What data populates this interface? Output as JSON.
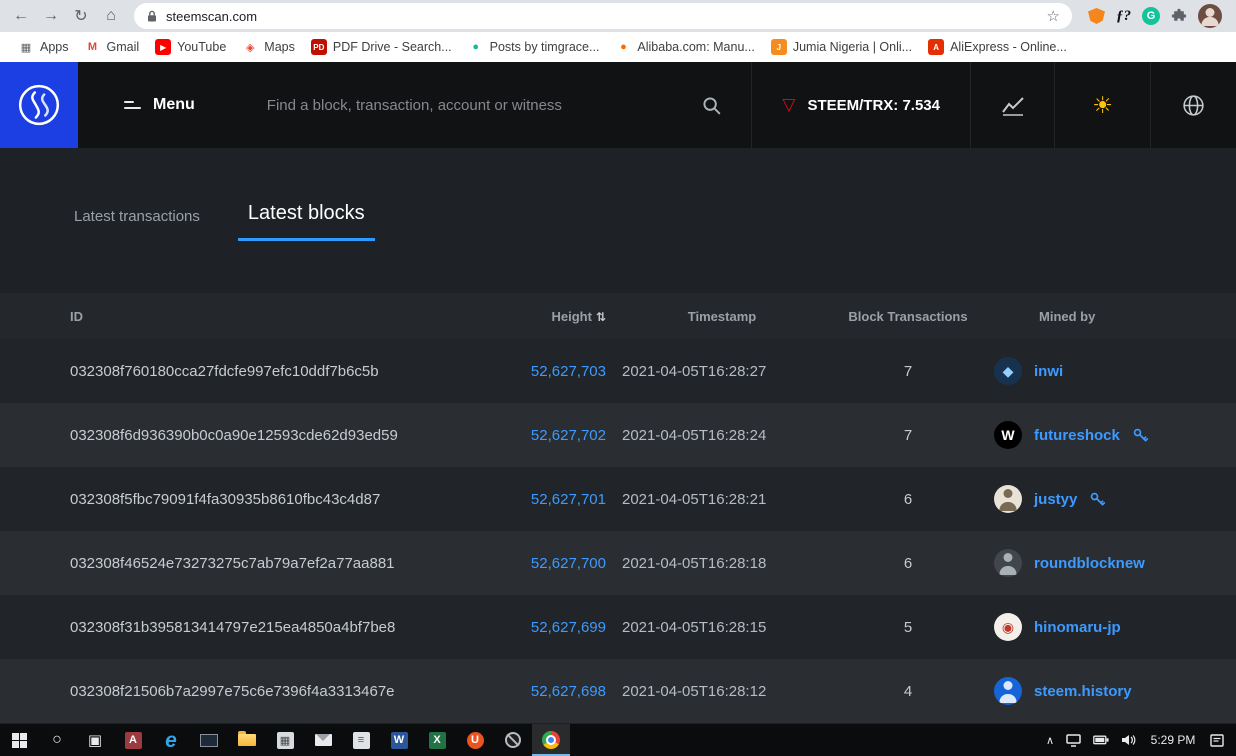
{
  "icons": {
    "back": "←",
    "forward": "→",
    "reload": "↻",
    "home": "⌂",
    "star": "☆",
    "extension_f": "ƒ?",
    "grammarly": "G",
    "sun": "☀",
    "tron": "▽",
    "sort": "⇅",
    "chevron_up": "∧"
  },
  "browser": {
    "url": "steemscan.com",
    "bookmarks": [
      {
        "label": "Apps",
        "glyph": "▦",
        "color": "#5f6368",
        "tile": false
      },
      {
        "label": "Gmail",
        "glyph": "M",
        "color": "#ea4335",
        "tile": false
      },
      {
        "label": "YouTube",
        "glyph": "▶",
        "color": "#ff0000",
        "tile": true
      },
      {
        "label": "Maps",
        "glyph": "◈",
        "color": "#ea4335",
        "tile": false
      },
      {
        "label": "PDF Drive - Search...",
        "glyph": "PD",
        "color": "#c00e00",
        "tile": true
      },
      {
        "label": "Posts by timgrace...",
        "glyph": "●",
        "color": "#17b79a",
        "tile": false
      },
      {
        "label": "Alibaba.com: Manu...",
        "glyph": "●",
        "color": "#ff6a00",
        "tile": false
      },
      {
        "label": "Jumia Nigeria | Onli...",
        "glyph": "J",
        "color": "#f68b1e",
        "tile": true
      },
      {
        "label": "AliExpress - Online...",
        "glyph": "A",
        "color": "#e62e04",
        "tile": true
      }
    ]
  },
  "site_header": {
    "menu_label": "Menu",
    "search_placeholder": "Find a block, transaction, account or witness",
    "pair_label": "STEEM/TRX: 7.534"
  },
  "tabs": {
    "transactions": "Latest transactions",
    "blocks": "Latest blocks"
  },
  "table": {
    "headers": {
      "id": "ID",
      "height": "Height",
      "timestamp": "Timestamp",
      "transactions": "Block Transactions",
      "mined_by": "Mined by"
    },
    "rows": [
      {
        "id": "032308f760180cca27fdcfe997efc10ddf7b6c5b",
        "height": "52,627,703",
        "timestamp": "2021-04-05T16:28:27",
        "transactions": "7",
        "miner": "inwi",
        "has_key": false,
        "avatar": {
          "type": "glyph",
          "glyph": "◆",
          "bg": "#16324f",
          "fg": "#8fd0ff"
        }
      },
      {
        "id": "032308f6d936390b0c0a90e12593cde62d93ed59",
        "height": "52,627,702",
        "timestamp": "2021-04-05T16:28:24",
        "transactions": "7",
        "miner": "futureshock",
        "has_key": true,
        "avatar": {
          "type": "glyph",
          "glyph": "W",
          "bg": "#000000",
          "fg": "#ffffff"
        }
      },
      {
        "id": "032308f5fbc79091f4fa30935b8610fbc43c4d87",
        "height": "52,627,701",
        "timestamp": "2021-04-05T16:28:21",
        "transactions": "6",
        "miner": "justyy",
        "has_key": true,
        "avatar": {
          "type": "person",
          "bg": "#e9e2d6",
          "fg": "#7a6a55"
        }
      },
      {
        "id": "032308f46524e73273275c7ab79a7ef2a77aa881",
        "height": "52,627,700",
        "timestamp": "2021-04-05T16:28:18",
        "transactions": "6",
        "miner": "roundblocknew",
        "has_key": false,
        "avatar": {
          "type": "person",
          "bg": "#40464c",
          "fg": "#a9b0b6"
        }
      },
      {
        "id": "032308f31b395813414797e215ea4850a4bf7be8",
        "height": "52,627,699",
        "timestamp": "2021-04-05T16:28:15",
        "transactions": "5",
        "miner": "hinomaru-jp",
        "has_key": false,
        "avatar": {
          "type": "glyph",
          "glyph": "◉",
          "bg": "#f4efe9",
          "fg": "#c0392b"
        }
      },
      {
        "id": "032308f21506b7a2997e75c6e7396f4a3313467e",
        "height": "52,627,698",
        "timestamp": "2021-04-05T16:28:12",
        "transactions": "4",
        "miner": "steem.history",
        "has_key": false,
        "avatar": {
          "type": "person",
          "bg": "#1565d8",
          "fg": "#dce9fb"
        }
      }
    ]
  },
  "taskbar": {
    "time": "5:29 PM",
    "apps": [
      {
        "name": "start-button",
        "kind": "start"
      },
      {
        "name": "cortana-search",
        "kind": "glyph",
        "glyph": "○",
        "color": "#e8eaed",
        "size": 16
      },
      {
        "name": "task-view",
        "kind": "glyph",
        "glyph": "▣",
        "color": "#e8eaed",
        "size": 15
      },
      {
        "name": "access-app",
        "kind": "tile",
        "glyph": "A",
        "bg": "#9c3b3f",
        "color": "#ffffff"
      },
      {
        "name": "edge-browser",
        "kind": "glyph",
        "glyph": "e",
        "color": "#35a3e8",
        "size": 21,
        "bold": true
      },
      {
        "name": "display-app",
        "kind": "screen"
      },
      {
        "name": "file-explorer",
        "kind": "folder"
      },
      {
        "name": "calculator-app",
        "kind": "tile",
        "glyph": "▦",
        "bg": "#d8dbde",
        "color": "#44474a"
      },
      {
        "name": "mail-app",
        "kind": "mail"
      },
      {
        "name": "notepad-app",
        "kind": "tile",
        "glyph": "≡",
        "bg": "#dfe3e6",
        "color": "#55585b"
      },
      {
        "name": "word-app",
        "kind": "tile",
        "glyph": "W",
        "bg": "#2b579a",
        "color": "#ffffff"
      },
      {
        "name": "excel-app",
        "kind": "tile",
        "glyph": "X",
        "bg": "#217346",
        "color": "#ffffff"
      },
      {
        "name": "ubuntu-app",
        "kind": "tile",
        "glyph": "U",
        "bg": "#e95420",
        "color": "#ffffff",
        "round": true
      },
      {
        "name": "blocked-app",
        "kind": "slash"
      },
      {
        "name": "chrome-browser",
        "kind": "chrome",
        "active": true
      }
    ]
  },
  "colors": {
    "brand_blue": "#1c3fe4",
    "link_blue": "#3d9aff",
    "tab_underline": "#2d9cff",
    "tron_red": "#e50915",
    "sun_yellow": "#ffc40a"
  }
}
